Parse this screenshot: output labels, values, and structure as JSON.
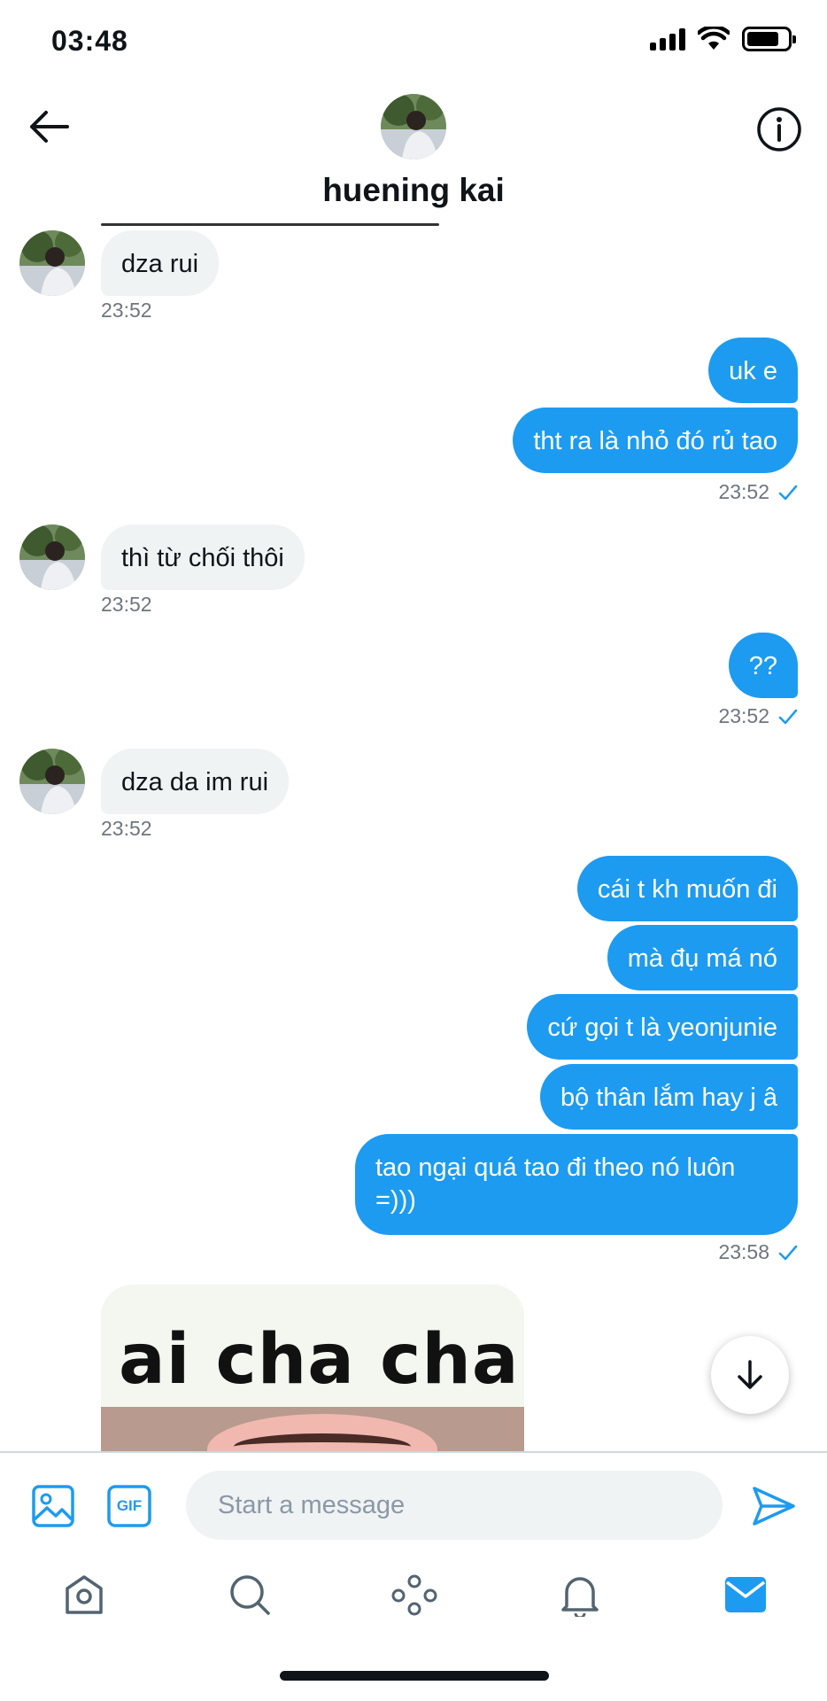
{
  "status_bar": {
    "time": "03:48"
  },
  "header": {
    "contact_name": "huening kai"
  },
  "messages": [
    {
      "text": "dza rui",
      "time": "23:52"
    },
    {
      "text": "uk e"
    },
    {
      "text": "tht ra là nhỏ đó rủ tao",
      "time": "23:52"
    },
    {
      "text": "thì từ chối thôi",
      "time": "23:52"
    },
    {
      "text": "??",
      "time": "23:52"
    },
    {
      "text": "dza da im rui",
      "time": "23:52"
    },
    {
      "text": "cái t kh muốn đi"
    },
    {
      "text": "mà đụ má nó"
    },
    {
      "text": "cứ gọi t là yeonjunie"
    },
    {
      "text": "bộ thân lắm hay j â"
    },
    {
      "text": "tao ngại quá tao đi theo nó luôn =)))",
      "time": "23:58"
    }
  ],
  "image_message": {
    "caption": "ai cha cha"
  },
  "composer": {
    "placeholder": "Start a message",
    "gif_label": "GIF"
  },
  "tabs": [
    "home",
    "search",
    "spaces",
    "notifications",
    "messages"
  ],
  "colors": {
    "accent": "#1d9bf0",
    "incoming_bubble": "#eff3f4"
  }
}
